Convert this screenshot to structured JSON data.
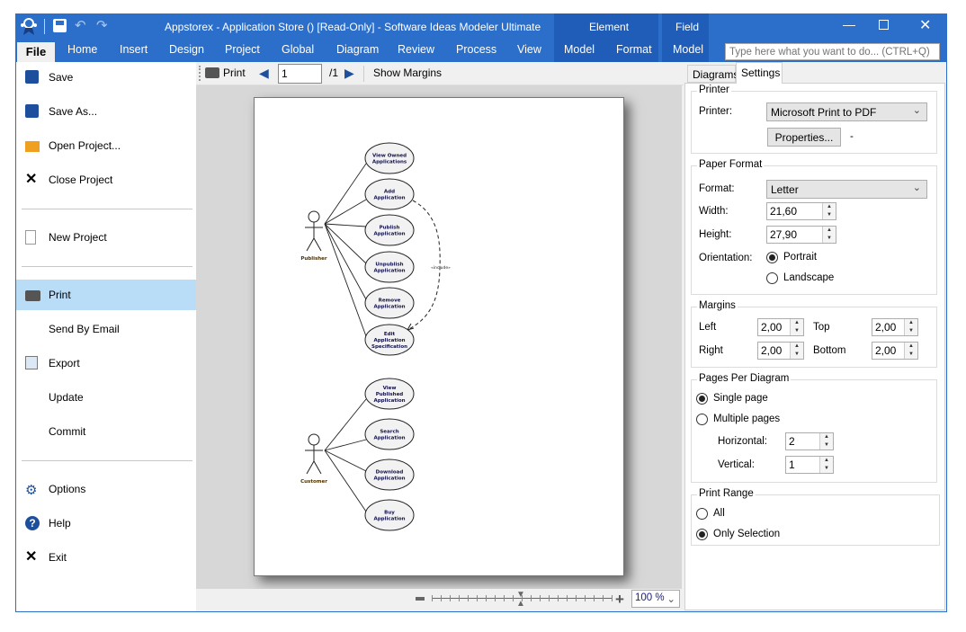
{
  "title": "Appstorex - Application Store () [Read-Only] - Software Ideas Modeler Ultimate",
  "context_groups": [
    "Element",
    "Field"
  ],
  "ribbon_tabs": [
    "File",
    "Home",
    "Insert",
    "Design",
    "Project",
    "Global",
    "Diagram",
    "Review",
    "Process",
    "View",
    "Model",
    "Format",
    "Model"
  ],
  "search_placeholder": "Type here what you want to do... (CTRL+Q)",
  "file_menu": [
    {
      "label": "Save",
      "icon": "save-icon"
    },
    {
      "label": "Save As...",
      "icon": "save-as-icon"
    },
    {
      "label": "Open Project...",
      "icon": "open-folder-icon"
    },
    {
      "label": "Close Project",
      "icon": "close-icon"
    },
    {
      "label": "New Project",
      "icon": "new-document-icon"
    },
    {
      "label": "Print",
      "icon": "printer-icon",
      "selected": true
    },
    {
      "label": "Send By Email",
      "icon": ""
    },
    {
      "label": "Export",
      "icon": "export-icon"
    },
    {
      "label": "Update",
      "icon": ""
    },
    {
      "label": "Commit",
      "icon": ""
    },
    {
      "label": "Options",
      "icon": "gears-icon"
    },
    {
      "label": "Help",
      "icon": "help-icon"
    },
    {
      "label": "Exit",
      "icon": "exit-icon"
    }
  ],
  "print_toolbar": {
    "print": "Print",
    "page": "1",
    "page_total": "/1",
    "show_margins": "Show Margins"
  },
  "zoom": {
    "value": "100 %",
    "slider_percent": 50
  },
  "diagram": {
    "actors": [
      {
        "name": "Publisher"
      },
      {
        "name": "Customer"
      }
    ],
    "publisher_use_cases": [
      [
        "View Owned",
        "Applications"
      ],
      [
        "Add",
        "Application"
      ],
      [
        "Publish",
        "Application"
      ],
      [
        "Unpublish",
        "Application"
      ],
      [
        "Remove",
        "Application"
      ],
      [
        "Edit",
        "Application",
        "Specification"
      ]
    ],
    "customer_use_cases": [
      [
        "View",
        "Published",
        "Application"
      ],
      [
        "Search",
        "Application"
      ],
      [
        "Download",
        "Application"
      ],
      [
        "Buy",
        "Application"
      ]
    ],
    "include_label": "«include»"
  },
  "panel": {
    "tabs": [
      "Diagrams",
      "Settings"
    ],
    "printer_group": "Printer",
    "printer_label": "Printer:",
    "printer_value": "Microsoft Print to PDF",
    "properties": "Properties...",
    "properties_status": "-",
    "paper_group": "Paper Format",
    "format_label": "Format:",
    "format_value": "Letter",
    "width_label": "Width:",
    "width_value": "21,60",
    "height_label": "Height:",
    "height_value": "27,90",
    "orientation_label": "Orientation:",
    "portrait": "Portrait",
    "landscape": "Landscape",
    "margins_group": "Margins",
    "left_label": "Left",
    "left_value": "2,00",
    "top_label": "Top",
    "top_value": "2,00",
    "right_label": "Right",
    "right_value": "2,00",
    "bottom_label": "Bottom",
    "bottom_value": "2,00",
    "pages_group": "Pages Per Diagram",
    "single_page": "Single page",
    "multiple_pages": "Multiple pages",
    "horizontal_label": "Horizontal:",
    "horizontal_value": "2",
    "vertical_label": "Vertical:",
    "vertical_value": "1",
    "range_group": "Print Range",
    "all": "All",
    "only_selection": "Only Selection"
  },
  "colors": {
    "accent": "#2b6fcb",
    "selected": "#b9dcf7"
  }
}
